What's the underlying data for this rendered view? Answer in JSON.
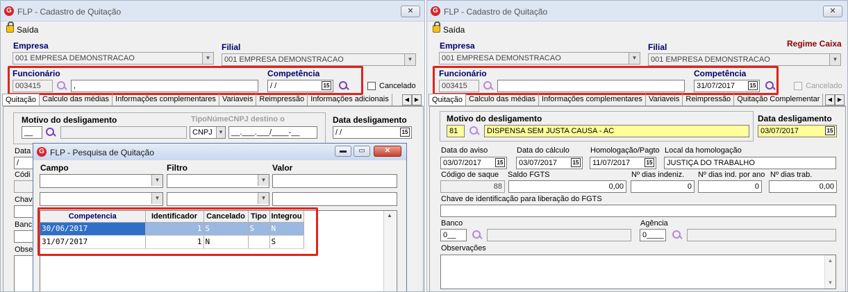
{
  "app": {
    "title": "FLP - Cadastro de Quitação",
    "exit_label": "Saída"
  },
  "left": {
    "empresa_label": "Empresa",
    "empresa_value": "001 EMPRESA DEMONSTRACAO",
    "filial_label": "Filial",
    "filial_value": "001 EMPRESA DEMONSTRACAO",
    "funcionario_label": "Funcionário",
    "funcionario_code": "003415",
    "funcionario_name": ",",
    "competencia_label": "Competência",
    "competencia_value": " / /",
    "cancelado_label": "Cancelado",
    "tabs": [
      "Quitação",
      "Calculo das médias",
      "Informações complementares",
      "Variaveis",
      "Reimpressão",
      "Informações adicionais"
    ],
    "motivo_label": "Motivo do desligamento",
    "motivo_code": "__",
    "tipo_label": "TipoNúmeCNPJ destino o",
    "cnpj_value": "CNPJ",
    "cnpj_mask": "__.___.___/____-__",
    "data_deslig_label": "Data desligamento",
    "data_deslig_value": " / /",
    "side_labels": [
      "Data",
      "Códi",
      "Chav",
      "Banc",
      "Obse"
    ],
    "data_field_value": " /"
  },
  "dialog": {
    "title": "FLP - Pesquisa de Quitação",
    "campo_label": "Campo",
    "filtro_label": "Filtro",
    "valor_label": "Valor",
    "columns": [
      "Competencia",
      "Identificador",
      "Cancelado",
      "Tipo",
      "Integrou"
    ],
    "rows": [
      {
        "competencia": "30/06/2017",
        "identificador": "1",
        "cancelado": "S",
        "tipo": "S",
        "integrou": "N"
      },
      {
        "competencia": "31/07/2017",
        "identificador": "1",
        "cancelado": "N",
        "tipo": "",
        "integrou": "S"
      }
    ]
  },
  "right": {
    "empresa_label": "Empresa",
    "empresa_value": "001 EMPRESA DEMONSTRACAO",
    "filial_label": "Filial",
    "filial_value": "001 EMPRESA DEMONSTRACAO",
    "regime_label": "Regime Caixa",
    "funcionario_label": "Funcionário",
    "funcionario_code": "003415",
    "funcionario_name": "",
    "competencia_label": "Competência",
    "competencia_value": "31/07/2017",
    "cancelado_label": "Cancelado",
    "tabs": [
      "Quitação",
      "Calculo das médias",
      "Informações complementares",
      "Variaveis",
      "Reimpressão",
      "Quitação Complementar"
    ],
    "motivo_label": "Motivo do desligamento",
    "motivo_code": "81",
    "motivo_desc": "DISPENSA SEM JUSTA CAUSA - AC",
    "data_deslig_label": "Data desligamento",
    "data_deslig_value": "03/07/2017",
    "data_aviso_label": "Data do aviso",
    "data_aviso_value": "03/07/2017",
    "data_calculo_label": "Data do cálculo",
    "data_calculo_value": "03/07/2017",
    "homologacao_label": "Homologação/Pagto",
    "homologacao_value": "11/07/2017",
    "local_label": "Local da homologação",
    "local_value": "JUSTIÇA DO TRABALHO",
    "codigo_saque_label": "Código de saque",
    "codigo_saque_value": "88",
    "saldo_fgts_label": "Saldo FGTS",
    "saldo_fgts_value": "0,00",
    "dias_indeniz_label": "Nº dias indeniz.",
    "dias_indeniz_value": "0",
    "dias_ind_ano_label": "Nº dias ind. por ano",
    "dias_ind_ano_value": "0",
    "dias_trab_label": "Nº dias trab.",
    "dias_trab_value": "0,00",
    "chave_label": "Chave de identificação para liberação do FGTS",
    "banco_label": "Banco",
    "banco_code": "0__",
    "agencia_label": "Agência",
    "agencia_code": "0____",
    "obs_label": "Observações"
  }
}
